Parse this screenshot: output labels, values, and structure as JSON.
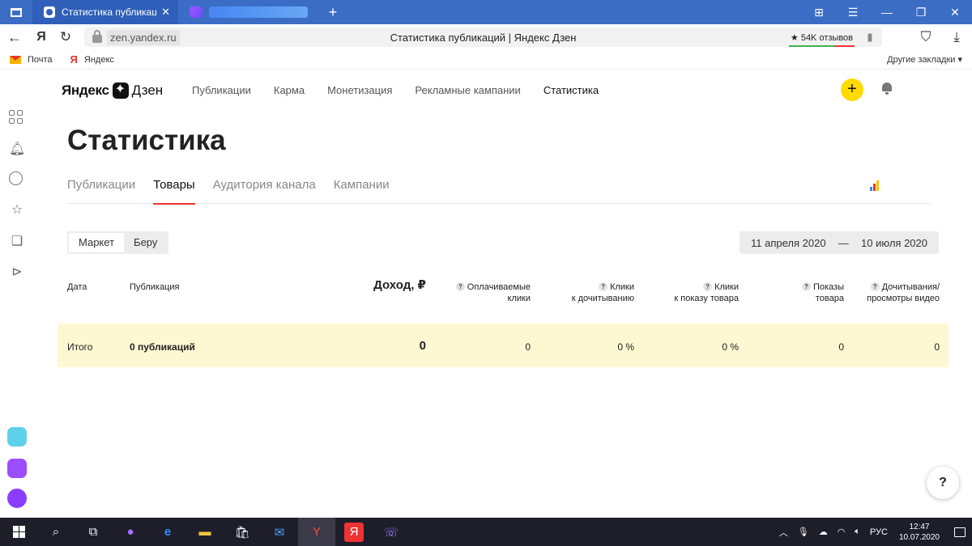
{
  "browser": {
    "tabs": [
      {
        "title": "Статистика публикаций"
      },
      {
        "title": ""
      }
    ],
    "address": {
      "domain": "zen.yandex.ru",
      "page_title": "Статистика публикаций | Яндекс Дзен",
      "reviews": "★ 54K отзывов"
    },
    "bookmarks": [
      {
        "label": "Почта"
      },
      {
        "label": "Яндекс"
      }
    ],
    "other_bookmarks": "Другие закладки"
  },
  "zen": {
    "logo_brand": "Яндекс",
    "logo_product": "Дзен",
    "nav": [
      {
        "label": "Публикации"
      },
      {
        "label": "Карма"
      },
      {
        "label": "Монетизация"
      },
      {
        "label": "Рекламные кампании"
      },
      {
        "label": "Статистика"
      }
    ],
    "heading": "Статистика",
    "subtabs": [
      {
        "label": "Публикации"
      },
      {
        "label": "Товары"
      },
      {
        "label": "Аудитория канала"
      },
      {
        "label": "Кампании"
      }
    ],
    "segments": [
      {
        "label": "Маркет"
      },
      {
        "label": "Беру"
      }
    ],
    "date_from": "11 апреля 2020",
    "date_sep": "—",
    "date_to": "10 июля 2020",
    "table": {
      "headers": {
        "date": "Дата",
        "publication": "Публикация",
        "income": "Доход, ₽",
        "paid_clicks_1": "Оплачиваемые",
        "paid_clicks_2": "клики",
        "clicks_read_1": "Клики",
        "clicks_read_2": "к дочитыванию",
        "clicks_show_1": "Клики",
        "clicks_show_2": "к показу товара",
        "shows_1": "Показы",
        "shows_2": "товара",
        "reads_1": "Дочитывания/",
        "reads_2": "просмотры видео"
      },
      "total": {
        "label": "Итого",
        "publications": "0 публикаций",
        "income": "0",
        "paid_clicks": "0",
        "clicks_read": "0 %",
        "clicks_show": "0 %",
        "shows": "0",
        "reads": "0"
      }
    },
    "help": "?"
  },
  "taskbar": {
    "lang": "РУС",
    "time": "12:47",
    "date": "10.07.2020"
  }
}
